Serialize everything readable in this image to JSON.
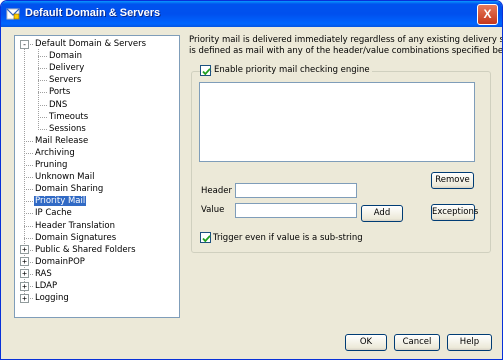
{
  "window": {
    "title": "Default Domain & Servers",
    "close_glyph": "X"
  },
  "tree": {
    "items": [
      {
        "label": "Default Domain & Servers",
        "level": 0,
        "expander": "-"
      },
      {
        "label": "Domain",
        "level": 1
      },
      {
        "label": "Delivery",
        "level": 1
      },
      {
        "label": "Servers",
        "level": 1
      },
      {
        "label": "Ports",
        "level": 1
      },
      {
        "label": "DNS",
        "level": 1
      },
      {
        "label": "Timeouts",
        "level": 1
      },
      {
        "label": "Sessions",
        "level": 1
      },
      {
        "label": "Mail Release",
        "level": 0
      },
      {
        "label": "Archiving",
        "level": 0
      },
      {
        "label": "Pruning",
        "level": 0
      },
      {
        "label": "Unknown Mail",
        "level": 0
      },
      {
        "label": "Domain Sharing",
        "level": 0
      },
      {
        "label": "Priority Mail",
        "level": 0,
        "selected": true
      },
      {
        "label": "IP Cache",
        "level": 0
      },
      {
        "label": "Header Translation",
        "level": 0
      },
      {
        "label": "Domain Signatures",
        "level": 0
      },
      {
        "label": "Public & Shared Folders",
        "level": 0,
        "expander": "+"
      },
      {
        "label": "DomainPOP",
        "level": 0,
        "expander": "+"
      },
      {
        "label": "RAS",
        "level": 0,
        "expander": "+"
      },
      {
        "label": "LDAP",
        "level": 0,
        "expander": "+"
      },
      {
        "label": "Logging",
        "level": 0,
        "expander": "+"
      }
    ]
  },
  "main": {
    "description_line1": "Priority mail is delivered immediately regardless of any existing delivery schedule and",
    "description_line2": "is defined as mail with any of the header/value combinations specified below.",
    "enable_checkbox": {
      "label": "Enable priority mail checking engine",
      "checked": true
    },
    "rules_list": [],
    "remove_button": "Remove",
    "header_label": "Header",
    "header_value": "",
    "value_label": "Value",
    "value_value": "",
    "add_button": "Add",
    "exceptions_button": "Exceptions",
    "substring_checkbox": {
      "label": "Trigger even if value is a sub-string",
      "checked": true
    }
  },
  "footer": {
    "ok": "OK",
    "cancel": "Cancel",
    "help": "Help"
  },
  "colors": {
    "selection": "#316ac5",
    "titlebar": "#0054e3",
    "dialog_bg": "#ece9d8"
  }
}
